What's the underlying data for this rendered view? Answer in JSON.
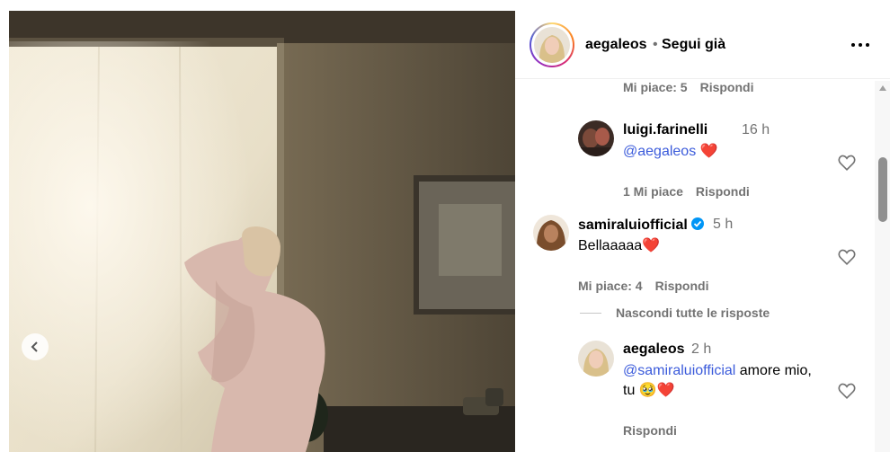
{
  "header": {
    "username": "aegaleos",
    "separator": "•",
    "follow_status": "Segui già",
    "more_icon": "more-horizontal-icon"
  },
  "comments": [
    {
      "type": "meta-only",
      "likes": "Mi piace: 5",
      "reply": "Rispondi"
    },
    {
      "username": "luigi.farinelli",
      "time": "16 h",
      "mention": "@aegaleos",
      "text": "",
      "emoji": "❤️",
      "likes": "1 Mi piace",
      "reply": "Rispondi"
    },
    {
      "username": "samiraluiofficial",
      "verified": true,
      "time": "5 h",
      "text": "Bellaaaaa",
      "emoji": "❤️",
      "likes": "Mi piace: 4",
      "reply": "Rispondi"
    },
    {
      "username": "aegaleos",
      "time": "2 h",
      "mention": "@samiraluiofficial",
      "text": "amore mio,",
      "text2": "tu",
      "emoji": "🥹❤️",
      "reply": "Rispondi"
    }
  ],
  "hide_replies": "Nascondi tutte le risposte",
  "colors": {
    "mention": "#3b5bdb",
    "heart": "#e0245e",
    "muted": "#737373",
    "verified": "#0095f6"
  }
}
